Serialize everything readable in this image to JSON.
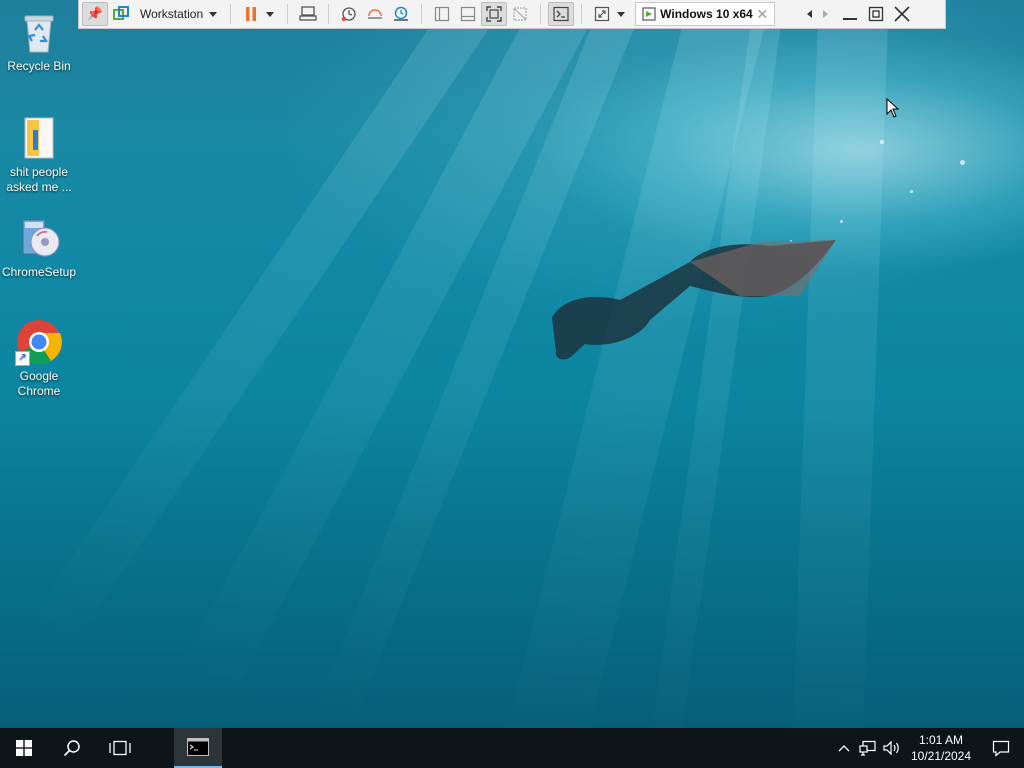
{
  "desktop": {
    "icons": [
      {
        "label": "Recycle Bin",
        "icon": "recycle-bin-icon"
      },
      {
        "label": "shit people asked me ...",
        "icon": "text-file-icon"
      },
      {
        "label": "ChromeSetup",
        "icon": "installer-icon"
      },
      {
        "label": "Google Chrome",
        "icon": "chrome-icon"
      }
    ]
  },
  "vm_toolbar": {
    "product_label": "Workstation",
    "vm_tab_label": "Windows 10 x64",
    "tab_close": "✕",
    "accent_pause": "#e8752b"
  },
  "taskbar": {
    "time": "1:01 AM",
    "date": "10/21/2024",
    "bg_color": "#0d1519"
  }
}
